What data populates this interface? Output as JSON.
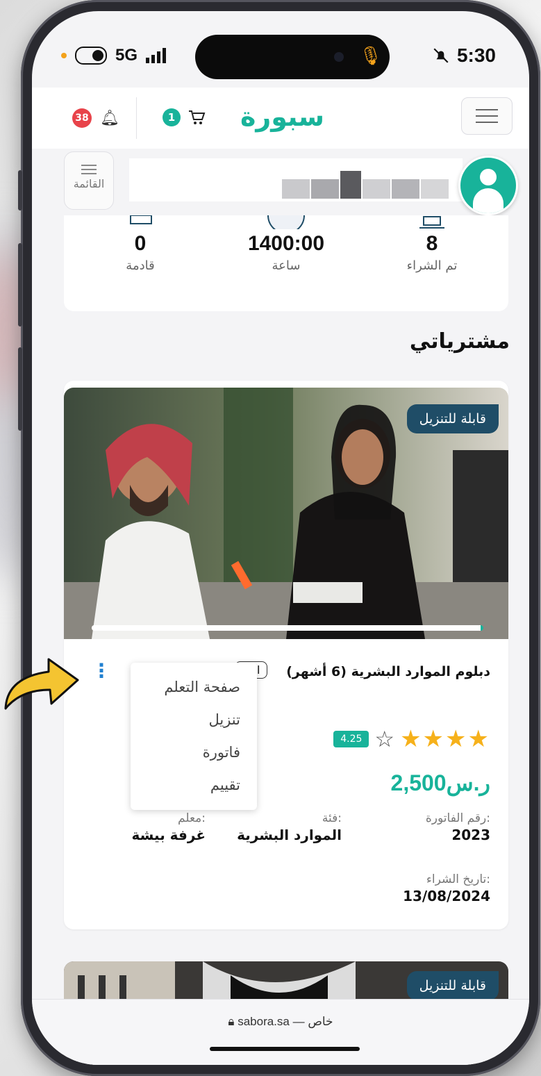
{
  "status_bar": {
    "network": "5G",
    "time": "5:30"
  },
  "header": {
    "brand": "سبورة",
    "cart_count": "1",
    "notification_count": "38"
  },
  "userbar": {
    "menu_label": "القائمة"
  },
  "stats": [
    {
      "value": "8",
      "label": "تم الشراء"
    },
    {
      "value": "1400:00",
      "label": "ساعة"
    },
    {
      "value": "0",
      "label": "قادمة"
    }
  ],
  "section_title": "مشترياتي",
  "course": {
    "download_tag": "قابلة للتنزيل",
    "title": "دبلوم الموارد البشرية (6 أشهر)",
    "type_tag": "الدو",
    "rating": "4.25",
    "price": "2,500ر.س",
    "invoice_label": "رقم الفاتورة:",
    "invoice_value": "2023",
    "category_label": "فئة:",
    "category_value": "الموارد البشرية",
    "teacher_label": "معلم:",
    "teacher_value": "غرفة بيشة",
    "purchase_date_label": "تاريخ الشراء:",
    "purchase_date_value": "13/08/2024",
    "progress_fraction": 1.0
  },
  "menu": {
    "items": [
      "صفحة التعلم",
      "تنزيل",
      "فاتورة",
      "تقييم"
    ]
  },
  "course2": {
    "download_tag": "قابلة للتنزيل"
  },
  "browser": {
    "url": "sabora.sa — خاص"
  },
  "colors": {
    "brand": "#18b39a",
    "tag_bg": "#1f4d67",
    "badge_red": "#e8434a",
    "star": "#f6b11b"
  }
}
